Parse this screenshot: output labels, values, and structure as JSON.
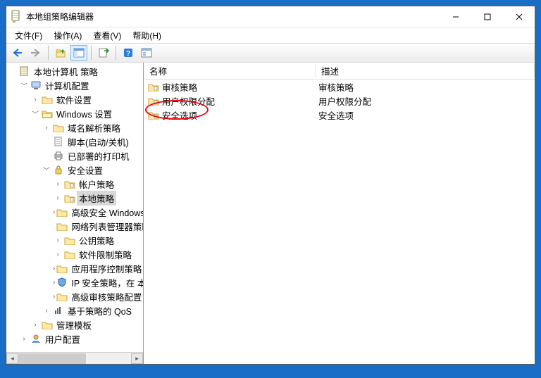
{
  "window": {
    "title": "本地组策略编辑器"
  },
  "menu": {
    "file": "文件(F)",
    "action": "操作(A)",
    "view": "查看(V)",
    "help": "帮助(H)"
  },
  "columns": {
    "name": "名称",
    "desc": "描述"
  },
  "list": {
    "items": [
      {
        "name": "审核策略",
        "desc": "审核策略"
      },
      {
        "name": "用户权限分配",
        "desc": "用户权限分配"
      },
      {
        "name": "安全选项",
        "desc": "安全选项"
      }
    ]
  },
  "tree": {
    "root": "本地计算机 策略",
    "computer_cfg": "计算机配置",
    "software_settings": "软件设置",
    "windows_settings": "Windows 设置",
    "dns_policy": "域名解析策略",
    "scripts": "脚本(启动/关机)",
    "printers": "已部署的打印机",
    "security_settings": "安全设置",
    "account_policies": "帐户策略",
    "local_policies": "本地策略",
    "adv_fw": "高级安全 Windows 防火墙",
    "netlist": "网络列表管理器策略",
    "pubkey": "公钥策略",
    "software_restrict": "软件限制策略",
    "appctrl": "应用程序控制策略",
    "ipsec": "IP 安全策略，在 本地计算机",
    "advaudit": "高级审核策略配置",
    "qos": "基于策略的 QoS",
    "admin_tmpl": "管理模板",
    "user_cfg": "用户配置"
  }
}
